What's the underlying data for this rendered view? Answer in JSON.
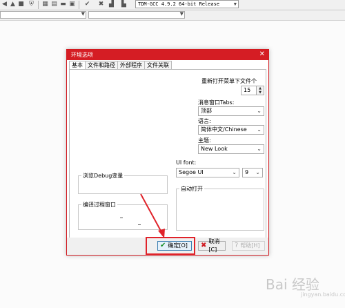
{
  "toolbar": {
    "compiler_select": "TDM-GCC 4.9.2 64-bit Release",
    "icons": [
      "nav-left-icon",
      "nav-up-icon",
      "shield-icon",
      "grid-icon",
      "table-icon",
      "window-icon",
      "panel-icon",
      "check-icon",
      "close-icon",
      "chart-icon",
      "tower-icon"
    ]
  },
  "dialog": {
    "title": "环境选项",
    "close_glyph": "✕",
    "tabs": [
      {
        "label": "基本",
        "active": true
      },
      {
        "label": "文件和路径",
        "active": false
      },
      {
        "label": "外部程序",
        "active": false
      },
      {
        "label": "文件关联",
        "active": false
      }
    ],
    "basic": {
      "reopen_label": "重新打开菜单下文件个",
      "reopen_value": "15",
      "msg_tabs_label": "消息窗口Tabs:",
      "msg_tabs_value": "顶部",
      "language_label": "语言:",
      "language_value": "简体中文/Chinese",
      "theme_label": "主题:",
      "theme_value": "New Look",
      "ui_font_label": "UI font:",
      "ui_font_value": "Segoe UI",
      "ui_font_size": "9",
      "debug_vars_label": "浏览Debug变量",
      "compile_window_label": "编译过程窗口",
      "autoopen_label": "自动打开"
    },
    "buttons": {
      "ok": "确定[O]",
      "cancel": "取消[C]",
      "help": "帮助[H]"
    }
  },
  "colors": {
    "titlebar": "#d51d24",
    "highlight": "#e0232a"
  },
  "watermark": {
    "text": "Bai 经验",
    "sub": "jingyan.baidu.com"
  }
}
